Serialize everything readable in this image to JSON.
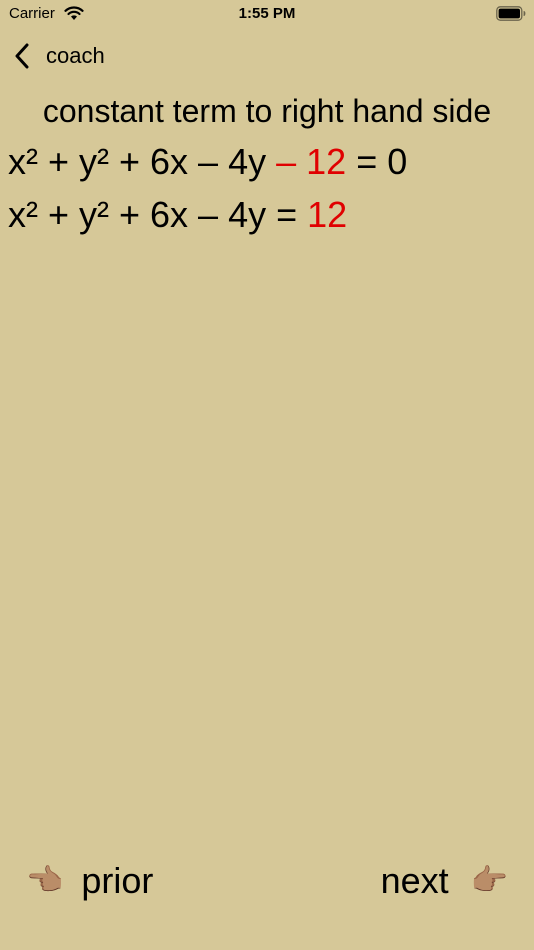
{
  "status_bar": {
    "carrier": "Carrier",
    "time": "1:55 PM",
    "wifi_icon": "wifi-icon",
    "battery_icon": "battery-icon"
  },
  "nav": {
    "back_label": "coach",
    "back_icon": "chevron-left-icon"
  },
  "step_title": "constant term to right hand side",
  "equations": [
    {
      "pre": "x² + y² + 6x – 4y ",
      "highlight": "– 12",
      "post": " = 0"
    },
    {
      "pre": "x² + y² + 6x – 4y = ",
      "highlight": "12",
      "post": ""
    }
  ],
  "footer": {
    "prior_label": "prior",
    "prior_icon": "👈🏽",
    "next_label": "next",
    "next_icon": "👉🏽"
  },
  "colors": {
    "background": "#d6c898",
    "highlight": "#e00000",
    "text": "#000000"
  }
}
